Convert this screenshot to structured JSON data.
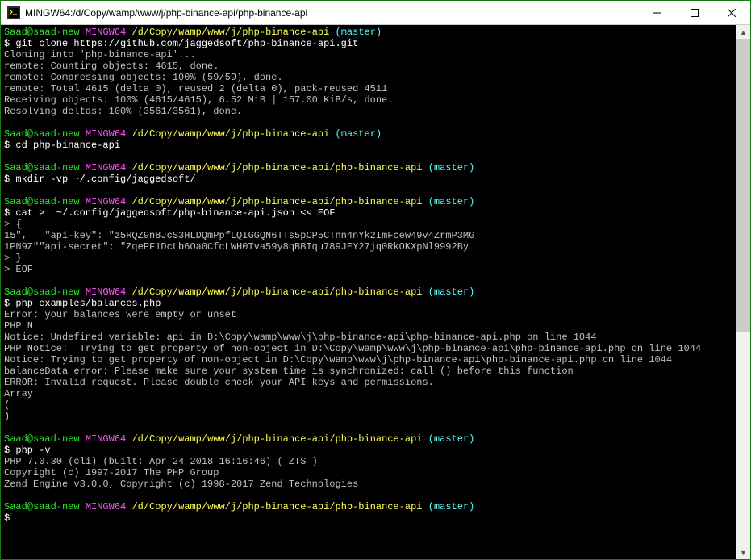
{
  "window": {
    "title": "MINGW64:/d/Copy/wamp/www/j/php-binance-api/php-binance-api"
  },
  "prompt": {
    "user": "Saad@saad-new",
    "ming": "MINGW64",
    "path_base": "/d/Copy/wamp/www/j/php-binance-api",
    "path_full": "/d/Copy/wamp/www/j/php-binance-api/php-binance-api",
    "branch": "(master)",
    "dollar": "$"
  },
  "blocks": [
    {
      "cmd": "git clone https://github.com/jaggedsoft/php-binance-api.git",
      "out": [
        "Cloning into 'php-binance-api'...",
        "remote: Counting objects: 4615, done.",
        "remote: Compressing objects: 100% (59/59), done.",
        "remote: Total 4615 (delta 0), reused 2 (delta 0), pack-reused 4511",
        "Receiving objects: 100% (4615/4615), 6.52 MiB | 157.00 KiB/s, done.",
        "Resolving deltas: 100% (3561/3561), done."
      ]
    },
    {
      "cmd": "cd php-binance-api",
      "out": []
    },
    {
      "cmd": "mkdir -vp ~/.config/jaggedsoft/",
      "out": []
    },
    {
      "cmd": "cat >  ~/.config/jaggedsoft/php-binance-api.json << EOF",
      "out": [
        "> {",
        "15\",   \"api-key\": \"z5RQZ9n8JcS3HLDQmPpfLQIGGQN6TTs5pCP5CTnn4nYk2ImFcew49v4ZrmP3MG",
        "1PN9Z\"\"api-secret\": \"ZqePF1DcLb6Oa0CfcLWH0Tva59y8qBBIqu789JEY27jq0RkOKXpNl9992By",
        "> }",
        "> EOF"
      ]
    },
    {
      "cmd": "php examples/balances.php",
      "out": [
        "Error: your balances were empty or unset",
        "PHP N",
        "Notice: Undefined variable: api in D:\\Copy\\wamp\\www\\j\\php-binance-api\\php-binance-api.php on line 1044",
        "PHP Notice:  Trying to get property of non-object in D:\\Copy\\wamp\\www\\j\\php-binance-api\\php-binance-api.php on line 1044",
        "",
        "Notice: Trying to get property of non-object in D:\\Copy\\wamp\\www\\j\\php-binance-api\\php-binance-api.php on line 1044",
        "balanceData error: Please make sure your system time is synchronized: call () before this function",
        "ERROR: Invalid request. Please double check your API keys and permissions.",
        "Array",
        "(",
        ")"
      ]
    },
    {
      "cmd": "php -v",
      "out": [
        "PHP 7.0.30 (cli) (built: Apr 24 2018 16:16:46) ( ZTS )",
        "Copyright (c) 1997-2017 The PHP Group",
        "Zend Engine v3.0.0, Copyright (c) 1998-2017 Zend Technologies"
      ]
    }
  ]
}
